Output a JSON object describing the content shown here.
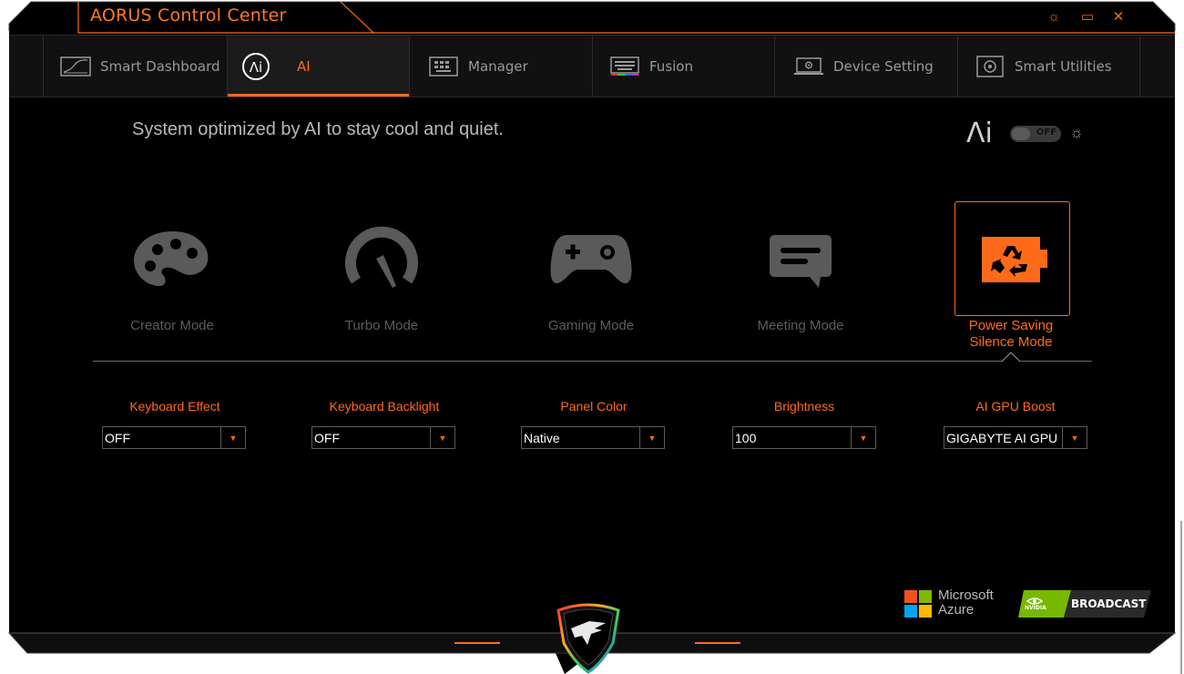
{
  "app": {
    "title": "AORUS Control Center",
    "accent_color": "#ff6a1a"
  },
  "window_controls": [
    {
      "name": "brightness-icon",
      "glyph": "☼"
    },
    {
      "name": "maximize-icon",
      "glyph": "▭"
    },
    {
      "name": "close-icon",
      "glyph": "✕"
    }
  ],
  "tabs": [
    {
      "label": "Smart Dashboard",
      "icon": "dashboard-icon"
    },
    {
      "label": "AI",
      "icon": "ai-icon",
      "active": true
    },
    {
      "label": "Manager",
      "icon": "keyboard-grid-icon"
    },
    {
      "label": "Fusion",
      "icon": "rgb-keyboard-icon"
    },
    {
      "label": "Device Setting",
      "icon": "laptop-gear-icon"
    },
    {
      "label": "Smart Utilities",
      "icon": "utilities-icon"
    }
  ],
  "ai_panel": {
    "tagline": "System optimized by AI to stay cool and quiet.",
    "ai_logo": "Λi",
    "toggle_label": "OFF",
    "modes": [
      {
        "label": "Creator Mode",
        "icon": "palette-icon"
      },
      {
        "label": "Turbo Mode",
        "icon": "speedometer-icon"
      },
      {
        "label": "Gaming Mode",
        "icon": "gamepad-icon"
      },
      {
        "label": "Meeting Mode",
        "icon": "chat-bubble-icon"
      },
      {
        "label_line1": "Power Saving",
        "label_line2": "Silence Mode",
        "icon": "battery-recycle-icon",
        "active": true
      }
    ],
    "settings": [
      {
        "label": "Keyboard Effect",
        "value": "OFF"
      },
      {
        "label": "Keyboard Backlight",
        "value": "OFF"
      },
      {
        "label": "Panel Color",
        "value": "Native"
      },
      {
        "label": "Brightness",
        "value": "100"
      },
      {
        "label": "AI GPU Boost",
        "value": "GIGABYTE AI GPU"
      }
    ]
  },
  "footer": {
    "microsoft_line1": "Microsoft",
    "microsoft_line2": "Azure",
    "nvidia_text": "NVIDIA",
    "broadcast_text": "BROADCAST"
  }
}
